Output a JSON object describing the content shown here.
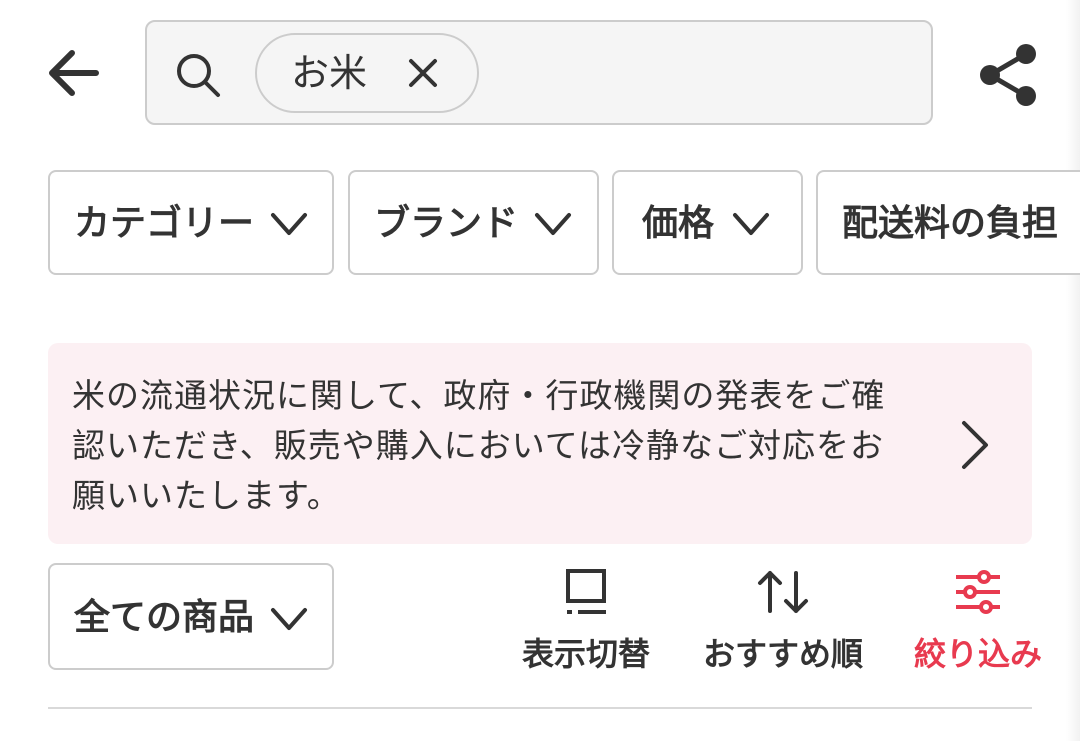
{
  "search": {
    "query_chip": "お米"
  },
  "filters": [
    {
      "label": "カテゴリー"
    },
    {
      "label": "ブランド"
    },
    {
      "label": "価格"
    },
    {
      "label": "配送料の負担"
    }
  ],
  "notice": {
    "text": "米の流通状況に関して、政府・行政機関の発表をご確認いただき、販売や購入においては冷静なご対応をお願いいたします。"
  },
  "toolbar": {
    "product_scope": "全ての商品",
    "display_toggle": "表示切替",
    "sort": "おすすめ順",
    "refine": "絞り込み"
  },
  "colors": {
    "accent": "#e83a4f",
    "notice_background": "#fcf0f3",
    "border": "#cccccc",
    "text": "#333333"
  }
}
